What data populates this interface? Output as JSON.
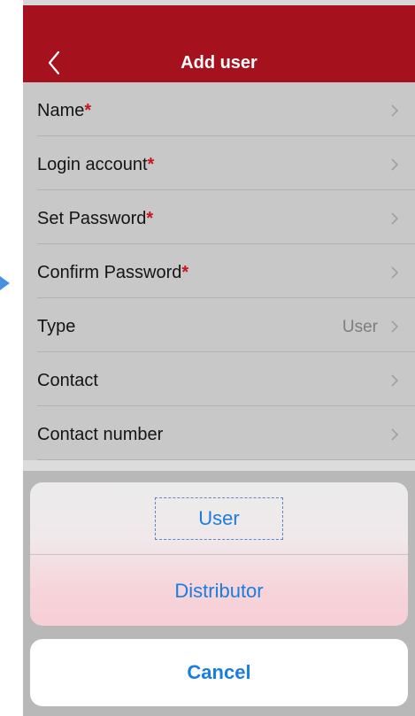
{
  "navbar": {
    "title": "Add user",
    "back_icon": "chevron-left-icon",
    "background_color": "#a5121e"
  },
  "form": {
    "required_mark": "*",
    "rows": [
      {
        "label": "Name",
        "required": true,
        "value": ""
      },
      {
        "label": "Login account",
        "required": true,
        "value": ""
      },
      {
        "label": "Set Password",
        "required": true,
        "value": ""
      },
      {
        "label": "Confirm Password",
        "required": true,
        "value": ""
      },
      {
        "label": "Type",
        "required": false,
        "value": "User"
      },
      {
        "label": "Contact",
        "required": false,
        "value": ""
      },
      {
        "label": "Contact number",
        "required": false,
        "value": ""
      }
    ]
  },
  "action_sheet": {
    "options": [
      "User",
      "Distributor"
    ],
    "selected": "User",
    "cancel_label": "Cancel",
    "accent_color": "#1a7de0"
  }
}
